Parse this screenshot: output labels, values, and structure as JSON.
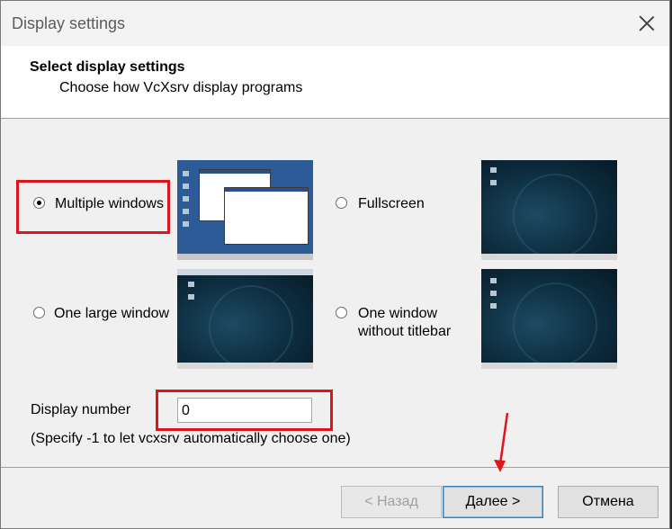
{
  "window": {
    "title": "Display settings"
  },
  "header": {
    "title": "Select display settings",
    "subtitle": "Choose how VcXsrv display programs"
  },
  "options": {
    "multiple": {
      "label": "Multiple windows",
      "selected": true
    },
    "fullscreen": {
      "label": "Fullscreen",
      "selected": false
    },
    "one_large": {
      "label": "One large window",
      "selected": false
    },
    "no_titlebar": {
      "label_line1": "One window",
      "label_line2": "without titlebar",
      "selected": false
    }
  },
  "display_number": {
    "label": "Display number",
    "value": "0",
    "hint": "(Specify -1 to let vcxsrv automatically choose one)"
  },
  "buttons": {
    "back": "< Назад",
    "next": "Далее >",
    "cancel": "Отмена"
  },
  "colors": {
    "highlight": "#e0141b",
    "annotation_arrow": "#e0141b"
  }
}
